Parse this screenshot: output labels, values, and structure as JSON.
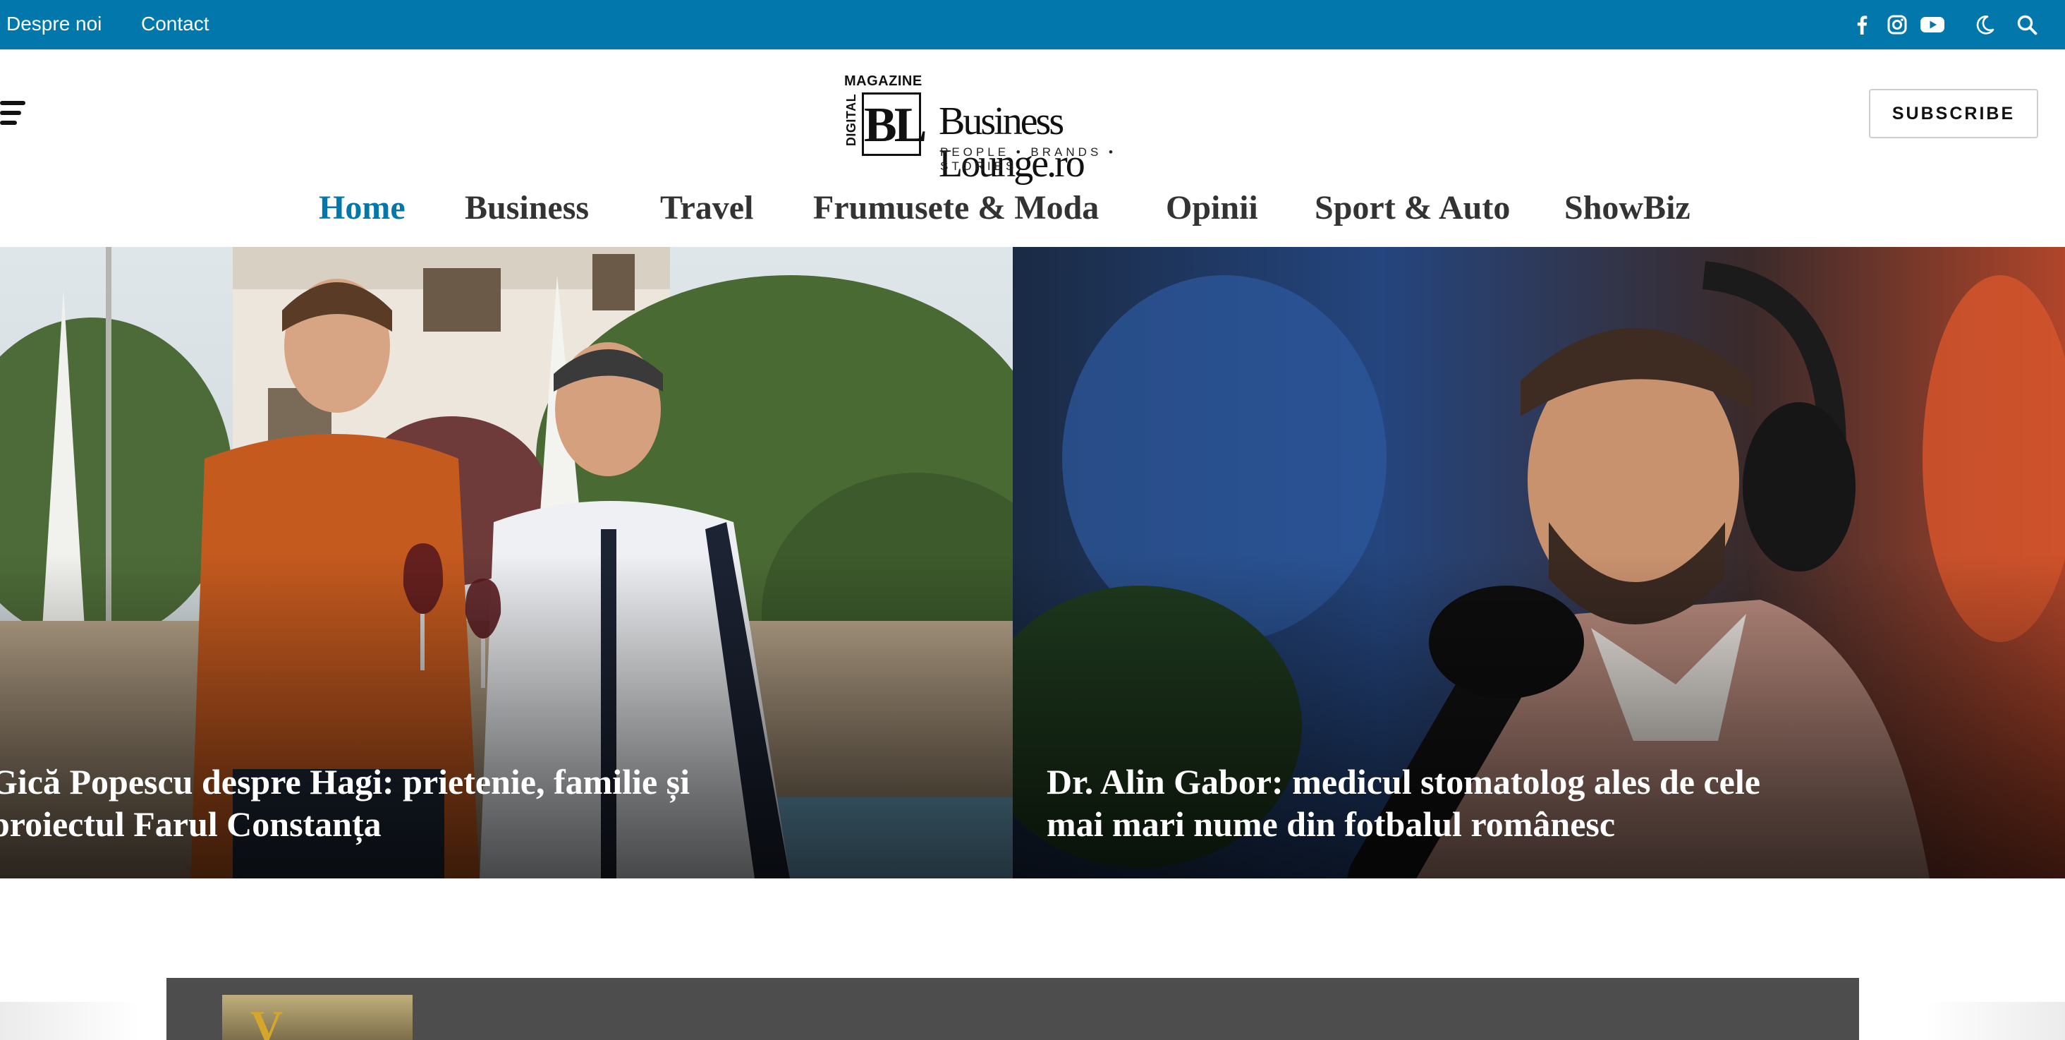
{
  "top_bar": {
    "links": [
      "Despre noi",
      "Contact"
    ],
    "icons": [
      "facebook-icon",
      "instagram-icon",
      "youtube-icon",
      "moon-icon",
      "search-icon"
    ],
    "background": "#0277ab"
  },
  "header": {
    "logo": {
      "magazine": "MAGAZINE",
      "digital": "DIGITAL",
      "monogram": "BL",
      "name": "Business Lounge.ro",
      "tagline": "PEOPLE • BRANDS • STORIES"
    },
    "subscribe_label": "SUBSCRIBE"
  },
  "nav": {
    "items": [
      "Home",
      "Business",
      "Travel",
      "Frumusete & Moda",
      "Opinii",
      "Sport & Auto",
      "ShowBiz"
    ],
    "active": "Home",
    "accent": "#0277ab"
  },
  "featured": [
    {
      "title_lines": [
        "Gică Popescu despre Hagi: prietenie, familie și",
        "proiectul Farul Constanța"
      ]
    },
    {
      "title_lines": [
        "Dr. Alin Gabor: medicul stomatolog ales de cele",
        "mai mari nume din fotbalul românesc"
      ]
    }
  ],
  "bottom": {
    "thumb_letter": "V"
  }
}
